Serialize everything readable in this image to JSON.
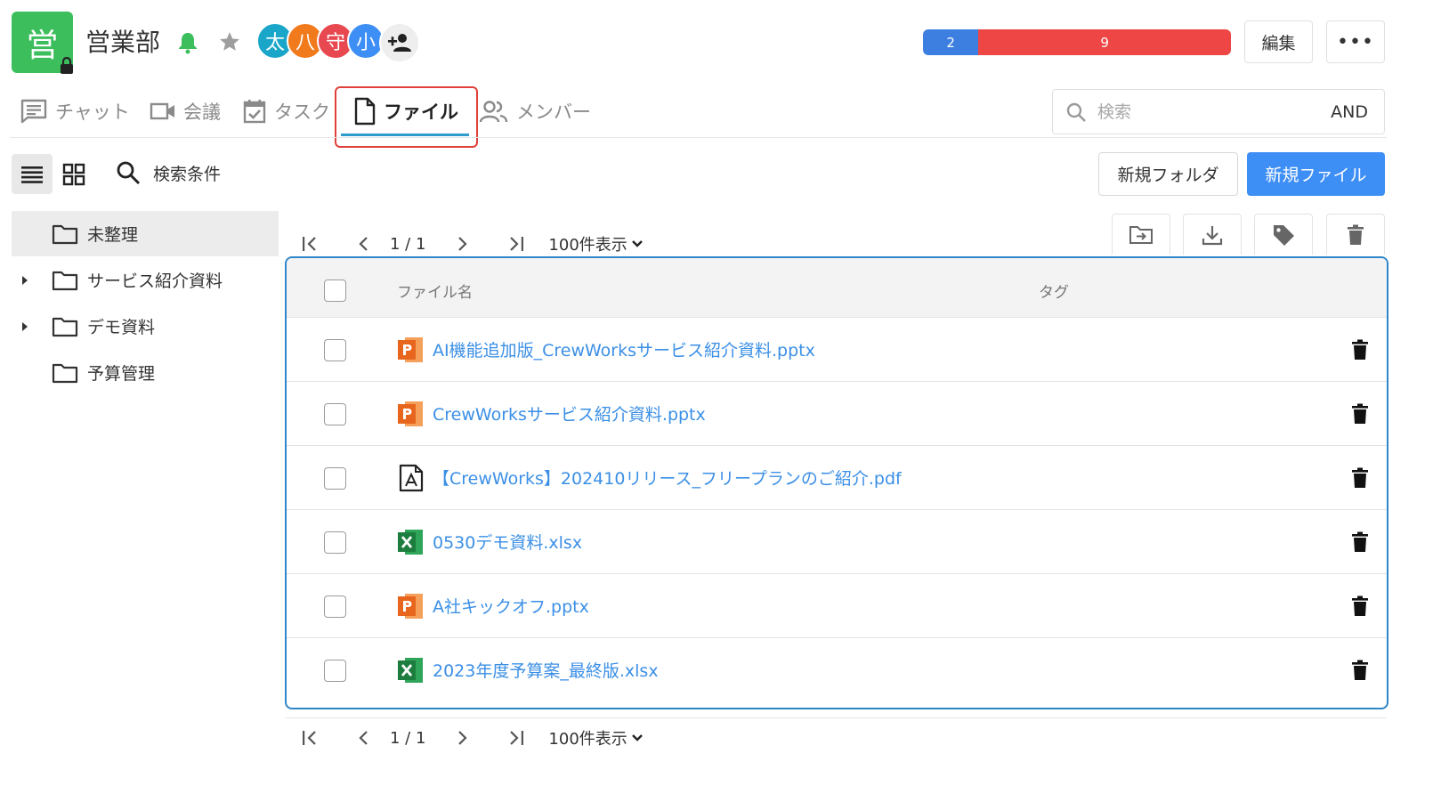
{
  "header": {
    "group_avatar_char": "営",
    "group_name": "営業部",
    "members": [
      {
        "char": "太",
        "color": "#1aa6c9"
      },
      {
        "char": "八",
        "color": "#f07a1c"
      },
      {
        "char": "守",
        "color": "#e84850"
      },
      {
        "char": "小",
        "color": "#3d8ef5"
      }
    ],
    "status": [
      {
        "value": "2",
        "color": "#3d7fe0",
        "fraction": 0.18
      },
      {
        "value": "9",
        "color": "#ee4545",
        "fraction": 0.82
      }
    ],
    "edit_label": "編集",
    "more_label": "•••"
  },
  "tabs": [
    {
      "label": "チャット",
      "icon": "chat-icon",
      "active": false
    },
    {
      "label": "会議",
      "icon": "video-icon",
      "active": false
    },
    {
      "label": "タスク",
      "icon": "task-icon",
      "active": false
    },
    {
      "label": "ファイル",
      "icon": "file-icon",
      "active": true
    },
    {
      "label": "メンバー",
      "icon": "members-icon",
      "active": false
    }
  ],
  "search": {
    "placeholder": "検索",
    "mode": "AND"
  },
  "toolbar": {
    "search_conditions_label": "検索条件",
    "new_folder_label": "新規フォルダ",
    "new_file_label": "新規ファイル"
  },
  "folders": [
    {
      "label": "未整理",
      "selected": true,
      "expandable": false
    },
    {
      "label": "サービス紹介資料",
      "selected": false,
      "expandable": true
    },
    {
      "label": "デモ資料",
      "selected": false,
      "expandable": true
    },
    {
      "label": "予算管理",
      "selected": false,
      "expandable": false
    }
  ],
  "pager": {
    "page": "1 / 1",
    "per_page": "100件表示"
  },
  "table": {
    "col_name": "ファイル名",
    "col_tag": "タグ",
    "files": [
      {
        "name": "AI機能追加版_CrewWorksサービス紹介資料.pptx",
        "type": "pptx"
      },
      {
        "name": "CrewWorksサービス紹介資料.pptx",
        "type": "pptx"
      },
      {
        "name": "【CrewWorks】202410リリース_フリープランのご紹介.pdf",
        "type": "pdf"
      },
      {
        "name": "0530デモ資料.xlsx",
        "type": "xlsx"
      },
      {
        "name": "A社キックオフ.pptx",
        "type": "pptx"
      },
      {
        "name": "2023年度予算案_最終版.xlsx",
        "type": "xlsx"
      }
    ]
  },
  "colors": {
    "accent": "#3d8ef5",
    "group": "#3dbe5d",
    "link": "#3b8fe6",
    "highlight": "#e0403a",
    "table_border": "#2f86c8"
  }
}
